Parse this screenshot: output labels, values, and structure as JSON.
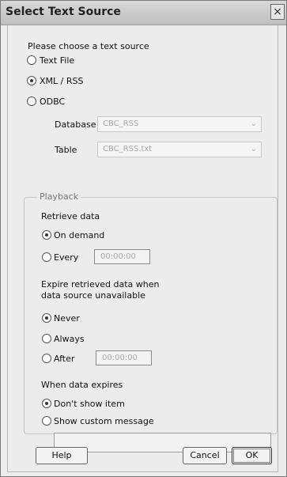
{
  "window": {
    "title": "Select Text Source",
    "close_label": "×"
  },
  "source": {
    "prompt": "Please choose a text source",
    "options": [
      {
        "label": "Text File",
        "selected": false
      },
      {
        "label": "XML / RSS",
        "selected": true
      },
      {
        "label": "ODBC",
        "selected": false
      }
    ],
    "database_label": "Database",
    "database_value": "CBC_RSS",
    "table_label": "Table",
    "table_value": "CBC_RSS.txt"
  },
  "playback": {
    "legend": "Playback",
    "retrieve_label": "Retrieve data",
    "retrieve_options": [
      {
        "label": "On demand",
        "selected": true
      },
      {
        "label": "Every",
        "selected": false
      }
    ],
    "every_time": "00:00:00",
    "expire_label_line1": "Expire retrieved data when",
    "expire_label_line2": "data source unavailable",
    "expire_options": [
      {
        "label": "Never",
        "selected": true
      },
      {
        "label": "Always",
        "selected": false
      },
      {
        "label": "After",
        "selected": false
      }
    ],
    "after_time": "00:00:00",
    "when_expires_label": "When data expires",
    "when_options": [
      {
        "label": "Don't show item",
        "selected": true
      },
      {
        "label": "Show custom message",
        "selected": false
      }
    ],
    "custom_message": ""
  },
  "buttons": {
    "help": "Help",
    "cancel": "Cancel",
    "ok": "OK"
  }
}
